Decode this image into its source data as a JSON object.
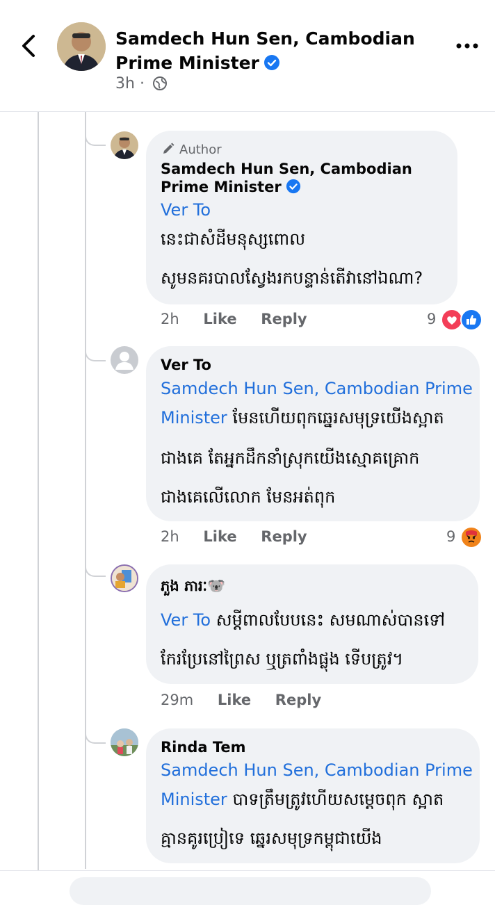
{
  "header": {
    "page_name": "Samdech Hun Sen, Cambodian Prime Minister",
    "time": "3h",
    "separator": "·"
  },
  "colors": {
    "link": "#216fdb",
    "verified": "#1877f2",
    "bubble": "#f0f2f5",
    "meta": "#65676b"
  },
  "comments": [
    {
      "author_tag": "Author",
      "name": "Samdech Hun Sen, Cambodian Prime Minister",
      "mention": "Ver To",
      "text_line1": "នេះជាសំដីមនុស្សពោល",
      "text_line2": "សូមនគរបាលស្វែងរកបន្ទាន់តើវានៅឯណា?",
      "time": "2h",
      "like": "Like",
      "reply": "Reply",
      "reactions": "9",
      "reaction_icons": [
        "love-icon",
        "like-icon"
      ]
    },
    {
      "name": "Ver To",
      "mention_line1": "Samdech Hun Sen, Cambodian Prime",
      "mention_line2": "Minister",
      "text_line2": "មែនហើយពុកឆ្នេរសមុទ្រយើងស្អាត",
      "text_line3": "ជាងគេ តែអ្នកដឹកនាំស្រុកយើងស្មោគគ្រោក",
      "text_line4": "ជាងគេលើលោក មែនអត់ពុក",
      "time": "2h",
      "like": "Like",
      "reply": "Reply",
      "reactions": "9",
      "reaction_icons": [
        "angry-icon"
      ]
    },
    {
      "name": "ភួង ភារៈ🐨",
      "mention": "Ver To",
      "text_line1": "សម្តីពាលបែបនេះ សមណាស់បានទៅ",
      "text_line2": "កែរប្រែនៅព្រៃស ឬត្រពាំងផ្លុង ទើបត្រូវ។",
      "time": "29m",
      "like": "Like",
      "reply": "Reply"
    },
    {
      "name": "Rinda Tem",
      "mention_line1": "Samdech Hun Sen, Cambodian Prime",
      "mention_line2": "Minister",
      "text_line2": "បាទត្រឹមត្រូវហើយសម្តេចពុក ស្អាត",
      "text_line3": "គ្មានគូរប្រៀទេ ឆ្នេរសមុទ្រកម្ពុជាយើង"
    }
  ]
}
